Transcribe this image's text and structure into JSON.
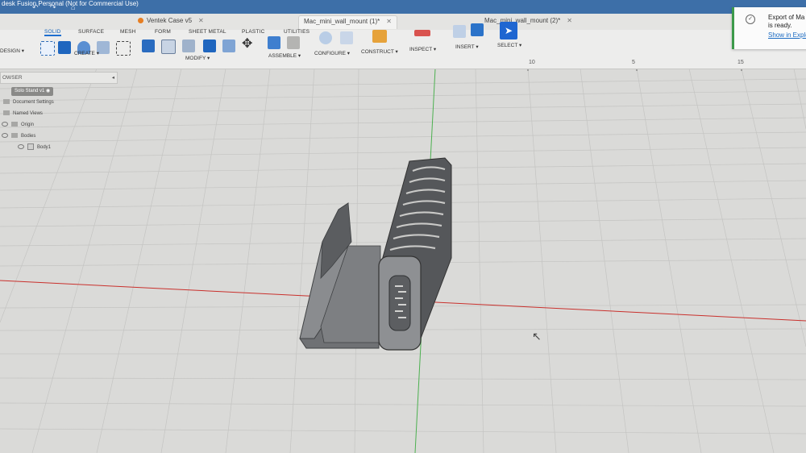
{
  "window": {
    "title": "desk Fusion Personal (Not for Commercial Use)"
  },
  "tabs": [
    {
      "label": "Ventek Case v5",
      "active": false
    },
    {
      "label": "Mac_mini_wall_mount (1)*",
      "active": true
    },
    {
      "label": "Mac_mini_wall_mount (2)*",
      "active": false
    }
  ],
  "toolbar": {
    "design_label": "DESIGN ▾",
    "workspace_tabs": [
      "SOLID",
      "SURFACE",
      "MESH",
      "FORM",
      "SHEET METAL",
      "PLASTIC",
      "UTILITIES"
    ],
    "groups": {
      "create": "CREATE ▾",
      "modify": "MODIFY ▾",
      "assemble": "ASSEMBLE ▾",
      "configure": "CONFIGURE ▾",
      "construct": "CONSTRUCT ▾",
      "inspect": "INSPECT ▾",
      "insert": "INSERT ▾",
      "select": "SELECT ▾"
    }
  },
  "notification": {
    "line1": "Export of Ma",
    "line2": "is ready.",
    "link": "Show in Explo"
  },
  "browser": {
    "header": "OWSER",
    "items": [
      {
        "label": "Solo Stand v1",
        "level": 0
      },
      {
        "label": "Document Settings",
        "level": 1
      },
      {
        "label": "Named Views",
        "level": 1
      },
      {
        "label": "Origin",
        "level": 1
      },
      {
        "label": "Bodies",
        "level": 1
      },
      {
        "label": "Body1",
        "level": 2
      }
    ]
  },
  "ruler_labels": [
    "10",
    "5",
    "15"
  ],
  "colors": {
    "title_bar": "#3d6fa8",
    "accent": "#1e6fd0",
    "grid_bg": "#dcdcda",
    "model_body": "#6b6d70",
    "x_axis": "#c9302c",
    "y_axis": "#3cb043"
  }
}
